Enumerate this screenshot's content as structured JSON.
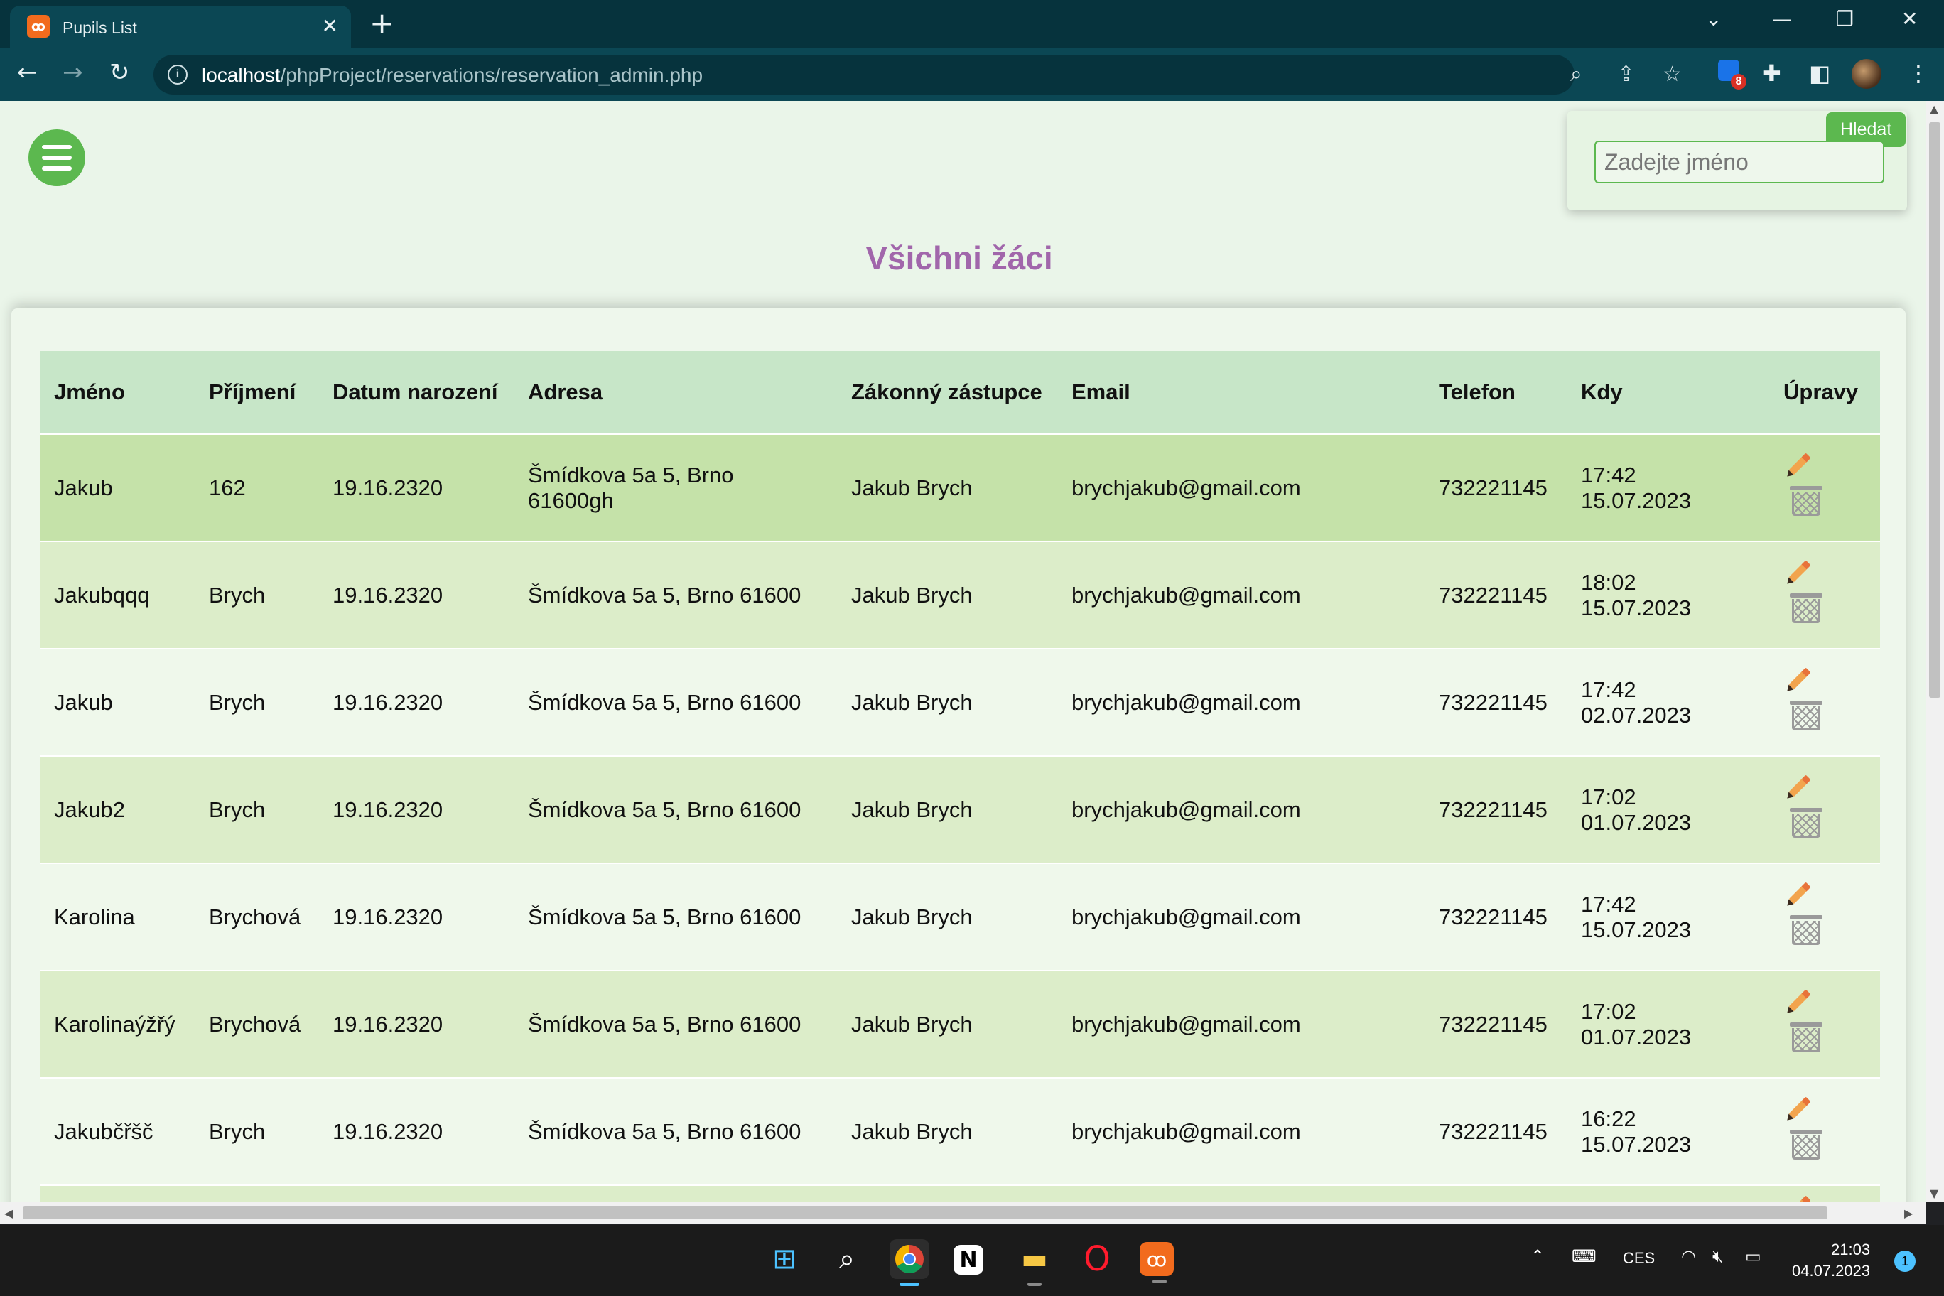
{
  "browser": {
    "tab_title": "Pupils List",
    "tab_favicon": "xampp-icon",
    "url_host": "localhost",
    "url_path": "/phpProject/reservations/reservation_admin.php",
    "extension_badge_count": "8"
  },
  "page": {
    "title": "Všichni žáci",
    "search": {
      "button_label": "Hledat",
      "placeholder": "Zadejte jméno",
      "value": ""
    }
  },
  "table": {
    "headers": [
      "Jméno",
      "Příjmení",
      "Datum narození",
      "Adresa",
      "Zákonný zástupce",
      "Email",
      "Telefon",
      "Kdy",
      "Úpravy"
    ],
    "rows": [
      {
        "jmeno": "Jakub",
        "prijmeni": "162",
        "datum": "19.16.2320",
        "adresa": "Šmídkova 5a 5, Brno 61600gh",
        "zastupce": "Jakub Brych",
        "email": "brychjakub@gmail.com",
        "telefon": "732221145",
        "kdy_cas": "17:42",
        "kdy_datum": "15.07.2023"
      },
      {
        "jmeno": "Jakubqqq",
        "prijmeni": "Brych",
        "datum": "19.16.2320",
        "adresa": "Šmídkova 5a 5, Brno 61600",
        "zastupce": "Jakub Brych",
        "email": "brychjakub@gmail.com",
        "telefon": "732221145",
        "kdy_cas": "18:02",
        "kdy_datum": "15.07.2023"
      },
      {
        "jmeno": "Jakub",
        "prijmeni": "Brych",
        "datum": "19.16.2320",
        "adresa": "Šmídkova 5a 5, Brno 61600",
        "zastupce": "Jakub Brych",
        "email": "brychjakub@gmail.com",
        "telefon": "732221145",
        "kdy_cas": "17:42",
        "kdy_datum": "02.07.2023"
      },
      {
        "jmeno": "Jakub2",
        "prijmeni": "Brych",
        "datum": "19.16.2320",
        "adresa": "Šmídkova 5a 5, Brno 61600",
        "zastupce": "Jakub Brych",
        "email": "brychjakub@gmail.com",
        "telefon": "732221145",
        "kdy_cas": "17:02",
        "kdy_datum": "01.07.2023"
      },
      {
        "jmeno": "Karolina",
        "prijmeni": "Brychová",
        "datum": "19.16.2320",
        "adresa": "Šmídkova 5a 5, Brno 61600",
        "zastupce": "Jakub Brych",
        "email": "brychjakub@gmail.com",
        "telefon": "732221145",
        "kdy_cas": "17:42",
        "kdy_datum": "15.07.2023"
      },
      {
        "jmeno": "Karolinaýžřý",
        "prijmeni": "Brychová",
        "datum": "19.16.2320",
        "adresa": "Šmídkova 5a 5, Brno 61600",
        "zastupce": "Jakub Brych",
        "email": "brychjakub@gmail.com",
        "telefon": "732221145",
        "kdy_cas": "17:02",
        "kdy_datum": "01.07.2023"
      },
      {
        "jmeno": "Jakubčřšč",
        "prijmeni": "Brych",
        "datum": "19.16.2320",
        "adresa": "Šmídkova 5a 5, Brno 61600",
        "zastupce": "Jakub Brych",
        "email": "brychjakub@gmail.com",
        "telefon": "732221145",
        "kdy_cas": "16:22",
        "kdy_datum": "15.07.2023"
      }
    ]
  },
  "taskbar": {
    "apps": [
      "windows-start-icon",
      "search-icon",
      "chrome-icon",
      "notion-icon",
      "file-explorer-icon",
      "opera-icon",
      "xampp-icon"
    ],
    "keyboard_layout": "CES",
    "time": "21:03",
    "date": "04.07.2023",
    "notification_count": "1"
  },
  "colors": {
    "chrome_dark": "#06333d",
    "chrome_toolbar": "#0b4754",
    "accent_green": "#5cb84f",
    "title_purple": "#a166ab",
    "header_row": "#c7e6c8",
    "row_highlight": "#c5e2a9",
    "row_alt": "#dcedc9",
    "row_light": "#eff8eb"
  }
}
